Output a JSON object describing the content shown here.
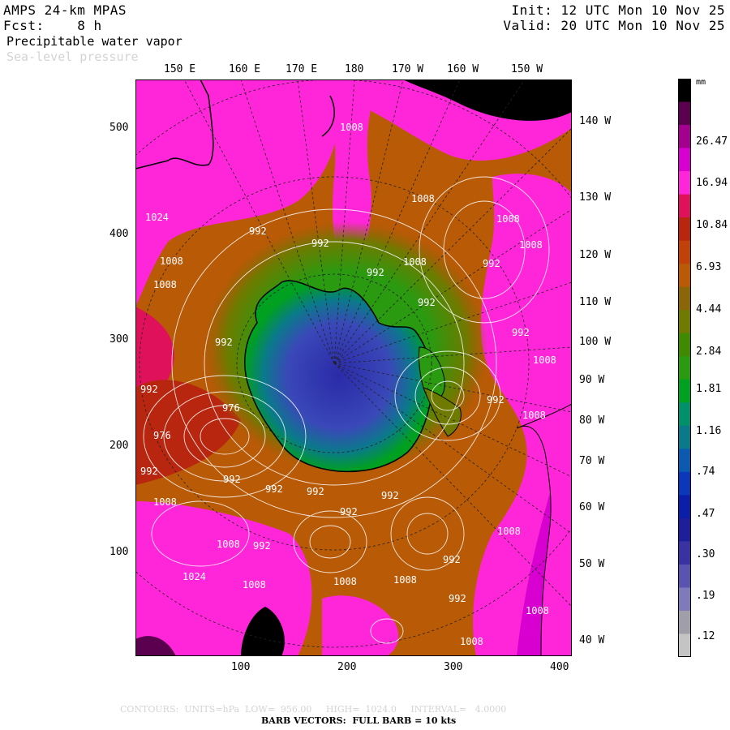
{
  "header": {
    "model": "AMPS 24-km MPAS",
    "forecast": "Fcst:    8 h",
    "field_primary": "Precipitable water vapor",
    "field_secondary": "Sea-level pressure",
    "init": "Init: 12 UTC Mon 10 Nov 25",
    "valid": "Valid: 20 UTC Mon 10 Nov 25"
  },
  "longitude_labels": [
    "150 E",
    "160 E",
    "170 E",
    "180",
    "170 W",
    "160 W",
    "150 W"
  ],
  "right_labels": [
    "140 W",
    "130 W",
    "120 W",
    "110 W",
    "100 W",
    "90 W",
    "80 W",
    "70 W",
    "60 W",
    "50 W",
    "40 W"
  ],
  "y_ticks": [
    "500",
    "400",
    "300",
    "200",
    "100"
  ],
  "x_ticks": [
    "100",
    "200",
    "300",
    "400"
  ],
  "colorbar": {
    "unit": "mm",
    "labels": [
      "26.47",
      "16.94",
      "10.84",
      "6.93",
      "4.44",
      "2.84",
      "1.81",
      "1.16",
      ".74",
      ".47",
      ".30",
      ".19",
      ".12"
    ],
    "colors": [
      "#000000",
      "#5a004f",
      "#a3008f",
      "#d800d0",
      "#ff26d9",
      "#e0115b",
      "#b8260f",
      "#c0420a",
      "#b85a06",
      "#8a6608",
      "#6f7a00",
      "#3f8a00",
      "#2a9a10",
      "#00a020",
      "#00906a",
      "#0a7a8a",
      "#0b5ab0",
      "#0a38b8",
      "#0a1ea8",
      "#1e1e9a",
      "#3a32a0",
      "#5a54b0",
      "#7f7aba",
      "#a09ea8",
      "#c4c4c4"
    ]
  },
  "isobar_labels": [
    "1024",
    "992",
    "992",
    "1008",
    "1008",
    "992",
    "976",
    "976",
    "992",
    "992",
    "1008",
    "1008",
    "992",
    "992",
    "992",
    "1008",
    "1024",
    "1008",
    "992",
    "1008",
    "1008",
    "1008",
    "992",
    "992",
    "1008",
    "1008",
    "992",
    "992",
    "1008",
    "992",
    "992",
    "1008",
    "1008",
    "992",
    "1008",
    "1008",
    "992",
    "992",
    "1008"
  ],
  "footer": {
    "contours": "CONTOURS:  UNITS=hPa  LOW=  956.00     HIGH=  1024.0     INTERVAL=   4.0000",
    "barbs": "BARB VECTORS:  FULL BARB = 10 kts"
  }
}
